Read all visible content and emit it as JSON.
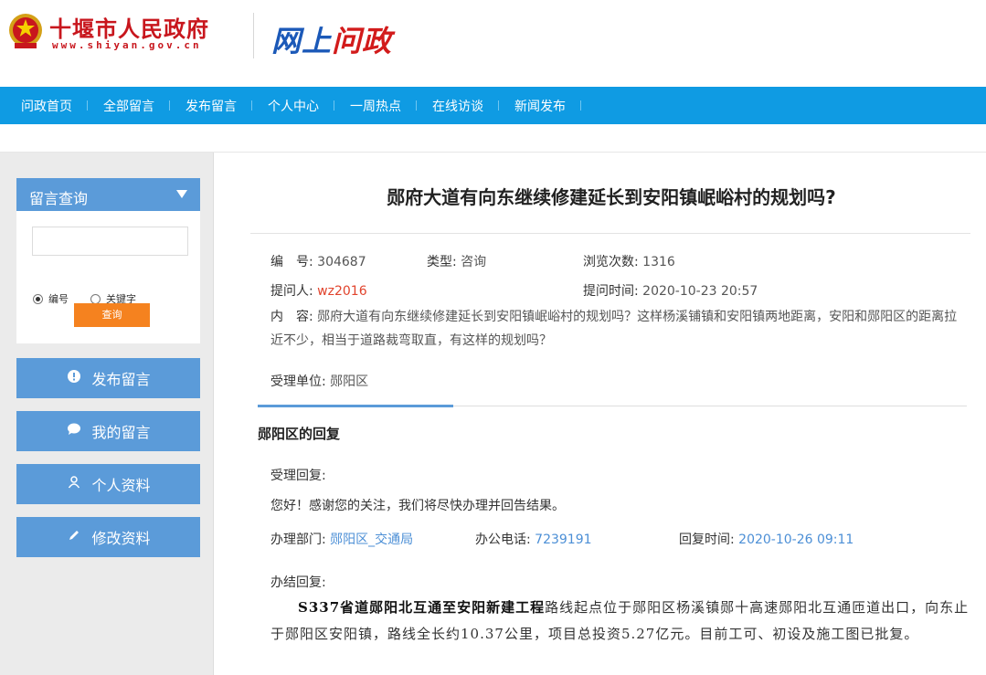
{
  "header": {
    "site_name": "十堰市人民政府",
    "site_url": "www.shiyan.gov.cn",
    "portal_logo_part1": "网上",
    "portal_logo_part2": "问政"
  },
  "nav": [
    "问政首页",
    "全部留言",
    "发布留言",
    "个人中心",
    "一周热点",
    "在线访谈",
    "新闻发布"
  ],
  "sidebar": {
    "query_title": "留言查询",
    "query_input_value": "",
    "radio_number": "编号",
    "radio_keyword": "关键字",
    "query_button": "查询",
    "buttons": [
      {
        "label": "发布留言",
        "icon": "exclamation-icon"
      },
      {
        "label": "我的留言",
        "icon": "chat-bubble-icon"
      },
      {
        "label": "个人资料",
        "icon": "person-icon"
      },
      {
        "label": "修改资料",
        "icon": "pencil-icon"
      }
    ]
  },
  "post": {
    "title": "郧府大道有向东继续修建延长到安阳镇岷峪村的规划吗?",
    "number_label": "编　号:",
    "number": "304687",
    "type_label": "类型:",
    "type": "咨询",
    "views_label": "浏览次数:",
    "views": "1316",
    "asker_label": "提问人:",
    "asker": "wz2016",
    "ask_time_label": "提问时间:",
    "ask_time": "2020-10-23 20:57",
    "content_label": "内　容:",
    "content": "郧府大道有向东继续修建延长到安阳镇岷峪村的规划吗？这样杨溪铺镇和安阳镇两地距离，安阳和郧阳区的距离拉近不少，相当于道路裁弯取直，有这样的规划吗？",
    "unit_label": "受理单位:",
    "unit": "郧阳区"
  },
  "reply": {
    "section_title": "郧阳区的回复",
    "accept_label": "受理回复:",
    "accept_text": "您好！感谢您的关注，我们将尽快办理并回告结果。",
    "dept_label": "办理部门:",
    "dept": "郧阳区_交通局",
    "phone_label": "办公电话:",
    "phone": "7239191",
    "reply_time_label": "回复时间:",
    "reply_time": "2020-10-26 09:11",
    "final_label": "办结回复:",
    "final_bold": "S337省道郧阳北互通至安阳新建工程",
    "final_text": "路线起点位于郧阳区杨溪镇郧十高速郧阳北互通匝道出口，向东止于郧阳区安阳镇，路线全长约10.37公里，项目总投资5.27亿元。目前工可、初设及施工图已批复。"
  },
  "colors": {
    "nav_blue": "#0f9be3",
    "side_blue": "#5b9bd9",
    "orange": "#f5821f",
    "red_text": "#e1432c",
    "link_blue": "#4c8fd6"
  }
}
